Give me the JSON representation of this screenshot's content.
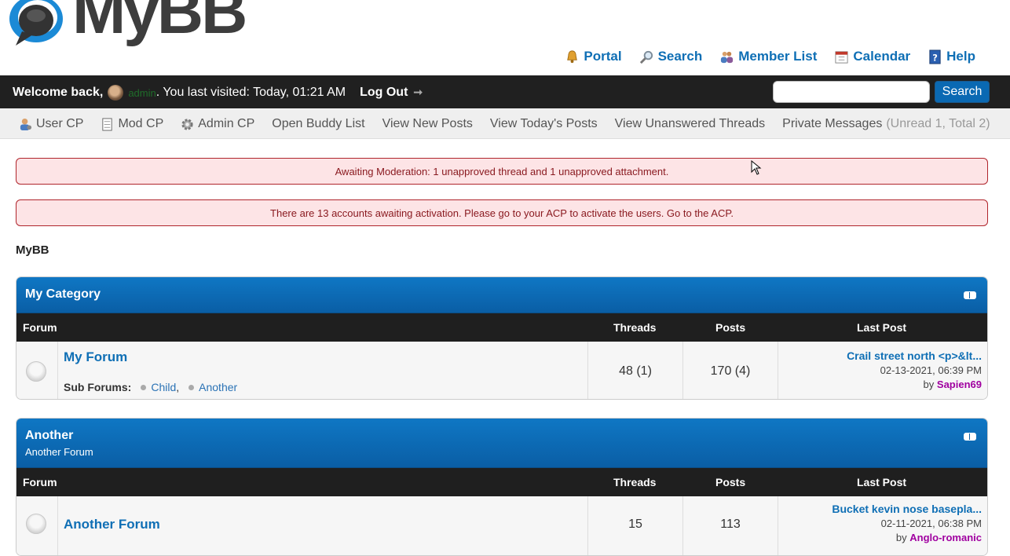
{
  "header": {
    "logo_text": "MyBB",
    "top_links": [
      {
        "label": "Portal",
        "icon": "bell-icon"
      },
      {
        "label": "Search",
        "icon": "magnifier-icon"
      },
      {
        "label": "Member List",
        "icon": "members-icon"
      },
      {
        "label": "Calendar",
        "icon": "calendar-icon"
      },
      {
        "label": "Help",
        "icon": "help-book-icon"
      }
    ]
  },
  "welcome": {
    "prefix": "Welcome back,",
    "username": "admin",
    "last_visit": ". You last visited: Today, 01:21 AM",
    "logout": "Log Out",
    "search_placeholder": "",
    "search_button": "Search"
  },
  "panel": {
    "items": [
      {
        "label": "User CP",
        "icon": "user-cp-icon"
      },
      {
        "label": "Mod CP",
        "icon": "mod-cp-icon"
      },
      {
        "label": "Admin CP",
        "icon": "gear-icon"
      },
      {
        "label": "Open Buddy List"
      },
      {
        "label": "View New Posts"
      },
      {
        "label": "View Today's Posts"
      },
      {
        "label": "View Unanswered Threads"
      },
      {
        "label": "Private Messages"
      }
    ],
    "pm_stats": "(Unread 1, Total 2)"
  },
  "alerts": [
    "Awaiting Moderation: 1 unapproved thread and 1 unapproved attachment.",
    "There are 13 accounts awaiting activation. Please go to your ACP to activate the users. Go to the ACP."
  ],
  "breadcrumb": "MyBB",
  "columns": {
    "forum": "Forum",
    "threads": "Threads",
    "posts": "Posts",
    "last_post": "Last Post"
  },
  "categories": [
    {
      "title": "My Category",
      "description": "",
      "forums": [
        {
          "name": "My Forum",
          "subforums_label": "Sub Forums:",
          "subforums": [
            "Child",
            "Another"
          ],
          "threads": "48 (1)",
          "posts": "170 (4)",
          "last_post_title": "Crail street north <p>&lt...",
          "last_post_date": "02-13-2021, 06:39 PM",
          "last_post_by": "by",
          "last_post_user": "Sapien69"
        }
      ]
    },
    {
      "title": "Another",
      "description": "Another Forum",
      "forums": [
        {
          "name": "Another Forum",
          "threads": "15",
          "posts": "113",
          "last_post_title": "Bucket kevin nose basepla...",
          "last_post_date": "02-11-2021, 06:38 PM",
          "last_post_by": "by",
          "last_post_user": "Anglo-romanic"
        }
      ]
    }
  ],
  "colors": {
    "accent": "#0f6fb5",
    "alert_bg": "#fde4e6",
    "alert_border": "#b0252c",
    "user_link": "#a000a0"
  }
}
